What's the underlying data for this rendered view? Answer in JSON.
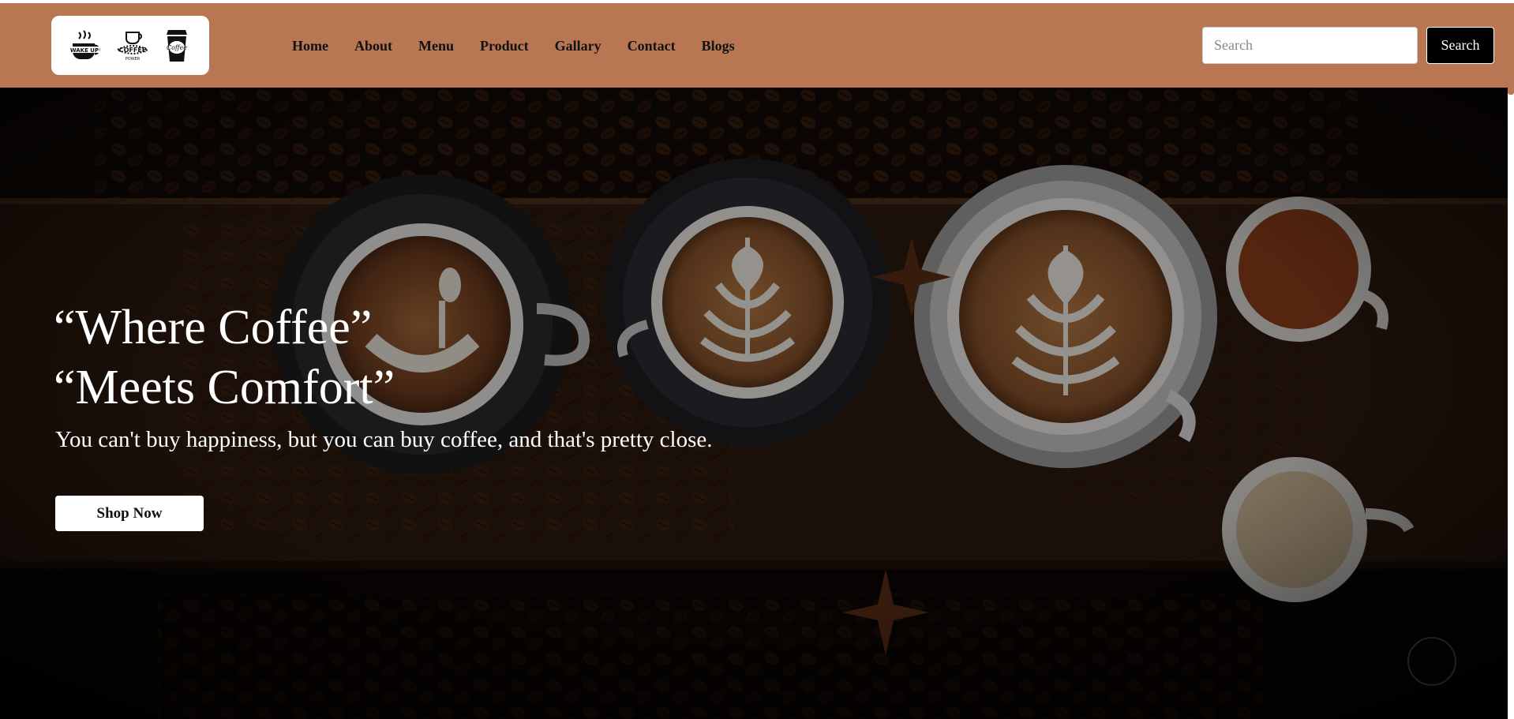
{
  "header": {
    "logos": [
      {
        "icon": "wake-up-cup-logo",
        "text": "WAKE UP"
      },
      {
        "icon": "coffee-power-logo",
        "text": "COFFEE"
      },
      {
        "icon": "coffee-cup-logo",
        "text": "Coffee"
      }
    ],
    "nav": [
      {
        "label": "Home"
      },
      {
        "label": "About"
      },
      {
        "label": "Menu"
      },
      {
        "label": "Product"
      },
      {
        "label": "Gallary"
      },
      {
        "label": "Contact"
      },
      {
        "label": "Blogs"
      }
    ],
    "search": {
      "placeholder": "Search",
      "value": "",
      "button_label": "Search"
    }
  },
  "hero": {
    "title_line1": "“Where Coffee”",
    "title_line2": "“Meets Comfort”",
    "subtitle": "You can't buy happiness, but you can buy coffee, and that's pretty close.",
    "cta_label": "Shop Now"
  },
  "colors": {
    "navbar": "#b87752",
    "hero_dark": "#0d0806",
    "wood": "#3a2416",
    "cta_bg": "#ffffff"
  }
}
